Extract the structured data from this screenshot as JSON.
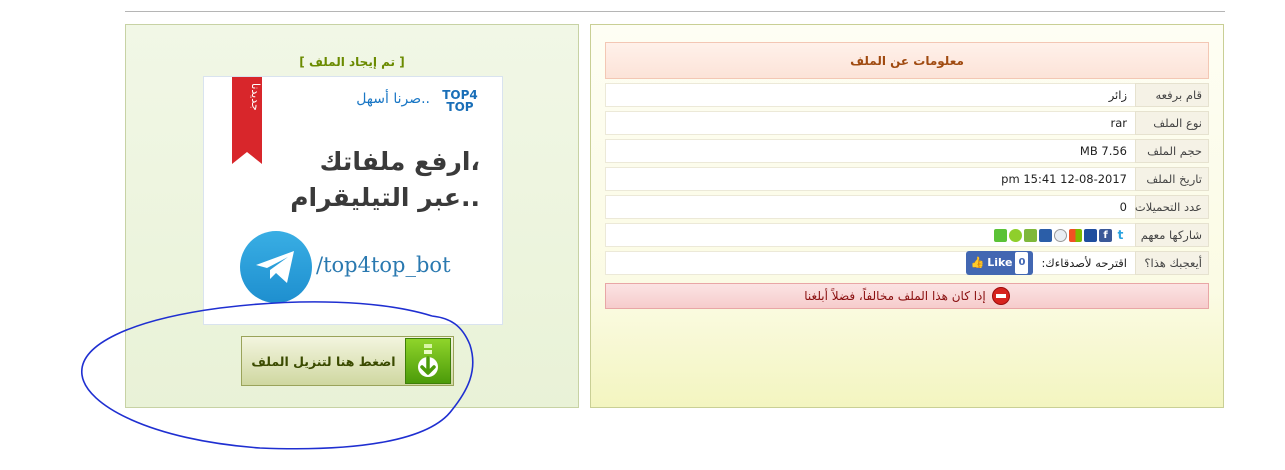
{
  "info": {
    "header": "معلومات عن الملف",
    "rows": [
      {
        "label": "قام برفعه",
        "value": "زائر"
      },
      {
        "label": "نوع الملف",
        "value": "rar"
      },
      {
        "label": "حجم الملف",
        "value": "7.56 MB"
      },
      {
        "label": "تاريخ الملف",
        "value": "12-08-2017 15:41 pm"
      },
      {
        "label": "عدد التحميلات",
        "value": "0"
      }
    ],
    "share_label": "شاركها معهم",
    "share_icons": [
      "twitter-icon",
      "facebook-icon",
      "myspace-icon",
      "windows-live-icon",
      "reddit-icon",
      "delicious-icon",
      "digg-icon",
      "stumbleupon-icon",
      "google-icon"
    ],
    "like_label": "أيعجبك هذا؟",
    "suggest_text": "اقترحه لأصدقاءك:",
    "fb_like_text": "Like",
    "fb_like_count": "0",
    "report_text": "إذا كان هذا الملف مخالفاً، فضلاً أبلغنا"
  },
  "download": {
    "found_title": "[ تم إيجاد الملف ]",
    "button_label": "اضغط هنا لتنزيل الملف",
    "ad": {
      "ribbon_text": "جديدنا",
      "logo_text": "TOP4TOP",
      "tagline": "صرنا أسهل..",
      "line1": "ارفع ملفاتك،",
      "line2": "عبر التيليقرام..",
      "handle": "/top4top_bot"
    }
  },
  "colors": {
    "accent_green": "#6a8a00",
    "header_orange": "#a04a10",
    "report_red": "#d6231e",
    "annotation_blue": "#1f2fd1"
  }
}
